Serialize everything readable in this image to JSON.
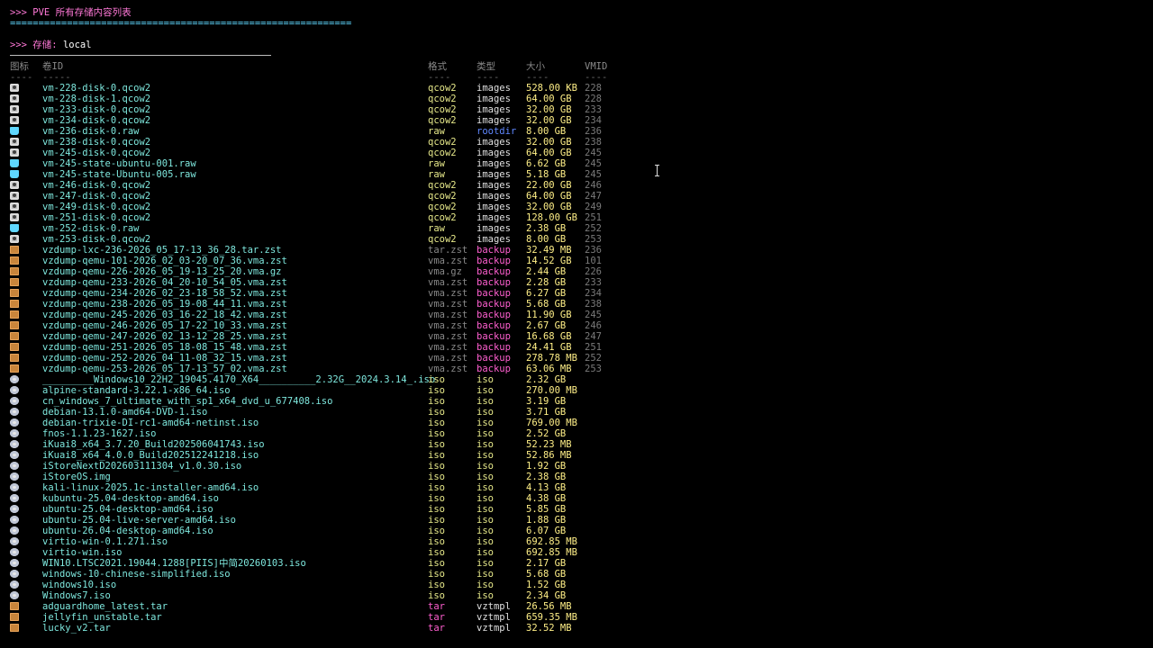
{
  "terminal": {
    "title": ">>> PVE 所有存储内容列表",
    "separator": "============================================================",
    "storage_prompt": ">>> 存储: ",
    "storage_name": "local",
    "headers": {
      "icon": "图标",
      "volume": "卷ID",
      "format": "格式",
      "type": "类型",
      "size": "大小",
      "vmid": "VMID"
    },
    "dashes": {
      "icon": "----",
      "volume": "-----",
      "format": "----",
      "type": "----",
      "size": "----",
      "vmid": "----"
    },
    "rows": [
      {
        "icon": "disk-icon",
        "volume": "vm-228-disk-0.qcow2",
        "format": "qcow2",
        "type": "images",
        "size": "528.00 KB",
        "vmid": "228"
      },
      {
        "icon": "disk-icon",
        "volume": "vm-228-disk-1.qcow2",
        "format": "qcow2",
        "type": "images",
        "size": "64.00 GB",
        "vmid": "228"
      },
      {
        "icon": "disk-icon",
        "volume": "vm-233-disk-0.qcow2",
        "format": "qcow2",
        "type": "images",
        "size": "32.00 GB",
        "vmid": "233"
      },
      {
        "icon": "disk-icon",
        "volume": "vm-234-disk-0.qcow2",
        "format": "qcow2",
        "type": "images",
        "size": "32.00 GB",
        "vmid": "234"
      },
      {
        "icon": "raw-disk-icon",
        "volume": "vm-236-disk-0.raw",
        "format": "raw",
        "type": "rootdir",
        "size": "8.00 GB",
        "vmid": "236"
      },
      {
        "icon": "disk-icon",
        "volume": "vm-238-disk-0.qcow2",
        "format": "qcow2",
        "type": "images",
        "size": "32.00 GB",
        "vmid": "238"
      },
      {
        "icon": "disk-icon",
        "volume": "vm-245-disk-0.qcow2",
        "format": "qcow2",
        "type": "images",
        "size": "64.00 GB",
        "vmid": "245"
      },
      {
        "icon": "raw-disk-icon",
        "volume": "vm-245-state-ubuntu-001.raw",
        "format": "raw",
        "type": "images",
        "size": "6.62 GB",
        "vmid": "245"
      },
      {
        "icon": "raw-disk-icon",
        "volume": "vm-245-state-Ubuntu-005.raw",
        "format": "raw",
        "type": "images",
        "size": "5.18 GB",
        "vmid": "245"
      },
      {
        "icon": "disk-icon",
        "volume": "vm-246-disk-0.qcow2",
        "format": "qcow2",
        "type": "images",
        "size": "22.00 GB",
        "vmid": "246"
      },
      {
        "icon": "disk-icon",
        "volume": "vm-247-disk-0.qcow2",
        "format": "qcow2",
        "type": "images",
        "size": "64.00 GB",
        "vmid": "247"
      },
      {
        "icon": "disk-icon",
        "volume": "vm-249-disk-0.qcow2",
        "format": "qcow2",
        "type": "images",
        "size": "32.00 GB",
        "vmid": "249"
      },
      {
        "icon": "disk-icon",
        "volume": "vm-251-disk-0.qcow2",
        "format": "qcow2",
        "type": "images",
        "size": "128.00 GB",
        "vmid": "251"
      },
      {
        "icon": "raw-disk-icon",
        "volume": "vm-252-disk-0.raw",
        "format": "raw",
        "type": "images",
        "size": "2.38 GB",
        "vmid": "252"
      },
      {
        "icon": "disk-icon",
        "volume": "vm-253-disk-0.qcow2",
        "format": "qcow2",
        "type": "images",
        "size": "8.00 GB",
        "vmid": "253"
      },
      {
        "icon": "package-icon",
        "volume": "vzdump-lxc-236-2026_05_17-13_36_28.tar.zst",
        "format": "tar.zst",
        "type": "backup",
        "size": "32.49 MB",
        "vmid": "236"
      },
      {
        "icon": "package-icon",
        "volume": "vzdump-qemu-101-2026_02_03-20_07_36.vma.zst",
        "format": "vma.zst",
        "type": "backup",
        "size": "14.52 GB",
        "vmid": "101"
      },
      {
        "icon": "package-icon",
        "volume": "vzdump-qemu-226-2026_05_19-13_25_20.vma.gz",
        "format": "vma.gz",
        "type": "backup",
        "size": "2.44 GB",
        "vmid": "226"
      },
      {
        "icon": "package-icon",
        "volume": "vzdump-qemu-233-2026_04_20-10_54_05.vma.zst",
        "format": "vma.zst",
        "type": "backup",
        "size": "2.28 GB",
        "vmid": "233"
      },
      {
        "icon": "package-icon",
        "volume": "vzdump-qemu-234-2026_02_23-18_58_52.vma.zst",
        "format": "vma.zst",
        "type": "backup",
        "size": "6.27 GB",
        "vmid": "234"
      },
      {
        "icon": "package-icon",
        "volume": "vzdump-qemu-238-2026_05_19-08_44_11.vma.zst",
        "format": "vma.zst",
        "type": "backup",
        "size": "5.68 GB",
        "vmid": "238"
      },
      {
        "icon": "package-icon",
        "volume": "vzdump-qemu-245-2026_03_16-22_18_42.vma.zst",
        "format": "vma.zst",
        "type": "backup",
        "size": "11.90 GB",
        "vmid": "245"
      },
      {
        "icon": "package-icon",
        "volume": "vzdump-qemu-246-2026_05_17-22_10_33.vma.zst",
        "format": "vma.zst",
        "type": "backup",
        "size": "2.67 GB",
        "vmid": "246"
      },
      {
        "icon": "package-icon",
        "volume": "vzdump-qemu-247-2026_02_13-12_28_25.vma.zst",
        "format": "vma.zst",
        "type": "backup",
        "size": "16.68 GB",
        "vmid": "247"
      },
      {
        "icon": "package-icon",
        "volume": "vzdump-qemu-251-2026_05_18-08_15_48.vma.zst",
        "format": "vma.zst",
        "type": "backup",
        "size": "24.41 GB",
        "vmid": "251"
      },
      {
        "icon": "package-icon",
        "volume": "vzdump-qemu-252-2026_04_11-08_32_15.vma.zst",
        "format": "vma.zst",
        "type": "backup",
        "size": "278.78 MB",
        "vmid": "252"
      },
      {
        "icon": "package-icon",
        "volume": "vzdump-qemu-253-2026_05_17-13_57_02.vma.zst",
        "format": "vma.zst",
        "type": "backup",
        "size": "63.06 MB",
        "vmid": "253"
      },
      {
        "icon": "cd-icon",
        "volume": "_________Windows10_22H2_19045.4170_X64__________2.32G__2024.3.14_.iso",
        "format": "iso",
        "type": "iso",
        "size": "2.32 GB",
        "vmid": ""
      },
      {
        "icon": "cd-icon",
        "volume": "alpine-standard-3.22.1-x86_64.iso",
        "format": "iso",
        "type": "iso",
        "size": "270.00 MB",
        "vmid": ""
      },
      {
        "icon": "cd-icon",
        "volume": "cn_windows_7_ultimate_with_sp1_x64_dvd_u_677408.iso",
        "format": "iso",
        "type": "iso",
        "size": "3.19 GB",
        "vmid": ""
      },
      {
        "icon": "cd-icon",
        "volume": "debian-13.1.0-amd64-DVD-1.iso",
        "format": "iso",
        "type": "iso",
        "size": "3.71 GB",
        "vmid": ""
      },
      {
        "icon": "cd-icon",
        "volume": "debian-trixie-DI-rc1-amd64-netinst.iso",
        "format": "iso",
        "type": "iso",
        "size": "769.00 MB",
        "vmid": ""
      },
      {
        "icon": "cd-icon",
        "volume": "fnos-1.1.23-1627.iso",
        "format": "iso",
        "type": "iso",
        "size": "2.52 GB",
        "vmid": ""
      },
      {
        "icon": "cd-icon",
        "volume": "iKuai8_x64_3.7.20_Build202506041743.iso",
        "format": "iso",
        "type": "iso",
        "size": "52.23 MB",
        "vmid": ""
      },
      {
        "icon": "cd-icon",
        "volume": "iKuai8_x64_4.0.0_Build202512241218.iso",
        "format": "iso",
        "type": "iso",
        "size": "52.86 MB",
        "vmid": ""
      },
      {
        "icon": "cd-icon",
        "volume": "iStoreNextD202603111304_v1.0.30.iso",
        "format": "iso",
        "type": "iso",
        "size": "1.92 GB",
        "vmid": ""
      },
      {
        "icon": "cd-icon",
        "volume": "iStoreOS.img",
        "format": "iso",
        "type": "iso",
        "size": "2.38 GB",
        "vmid": ""
      },
      {
        "icon": "cd-icon",
        "volume": "kali-linux-2025.1c-installer-amd64.iso",
        "format": "iso",
        "type": "iso",
        "size": "4.13 GB",
        "vmid": ""
      },
      {
        "icon": "cd-icon",
        "volume": "kubuntu-25.04-desktop-amd64.iso",
        "format": "iso",
        "type": "iso",
        "size": "4.38 GB",
        "vmid": ""
      },
      {
        "icon": "cd-icon",
        "volume": "ubuntu-25.04-desktop-amd64.iso",
        "format": "iso",
        "type": "iso",
        "size": "5.85 GB",
        "vmid": ""
      },
      {
        "icon": "cd-icon",
        "volume": "ubuntu-25.04-live-server-amd64.iso",
        "format": "iso",
        "type": "iso",
        "size": "1.88 GB",
        "vmid": ""
      },
      {
        "icon": "cd-icon",
        "volume": "ubuntu-26.04-desktop-amd64.iso",
        "format": "iso",
        "type": "iso",
        "size": "6.07 GB",
        "vmid": ""
      },
      {
        "icon": "cd-icon",
        "volume": "virtio-win-0.1.271.iso",
        "format": "iso",
        "type": "iso",
        "size": "692.85 MB",
        "vmid": ""
      },
      {
        "icon": "cd-icon",
        "volume": "virtio-win.iso",
        "format": "iso",
        "type": "iso",
        "size": "692.85 MB",
        "vmid": ""
      },
      {
        "icon": "cd-icon",
        "volume": "WIN10.LTSC2021.19044.1288[PIIS]中简20260103.iso",
        "format": "iso",
        "type": "iso",
        "size": "2.17 GB",
        "vmid": ""
      },
      {
        "icon": "cd-icon",
        "volume": "windows-10-chinese-simplified.iso",
        "format": "iso",
        "type": "iso",
        "size": "5.68 GB",
        "vmid": ""
      },
      {
        "icon": "cd-icon",
        "volume": "windows10.iso",
        "format": "iso",
        "type": "iso",
        "size": "1.52 GB",
        "vmid": ""
      },
      {
        "icon": "cd-icon",
        "volume": "Windows7.iso",
        "format": "iso",
        "type": "iso",
        "size": "2.34 GB",
        "vmid": ""
      },
      {
        "icon": "package-icon",
        "volume": "adguardhome_latest.tar",
        "format": "tar",
        "type": "vztmpl",
        "size": "26.56 MB",
        "vmid": ""
      },
      {
        "icon": "package-icon",
        "volume": "jellyfin_unstable.tar",
        "format": "tar",
        "type": "vztmpl",
        "size": "659.35 MB",
        "vmid": ""
      },
      {
        "icon": "package-icon",
        "volume": "lucky_v2.tar",
        "format": "tar",
        "type": "vztmpl",
        "size": "32.52 MB",
        "vmid": ""
      }
    ]
  }
}
